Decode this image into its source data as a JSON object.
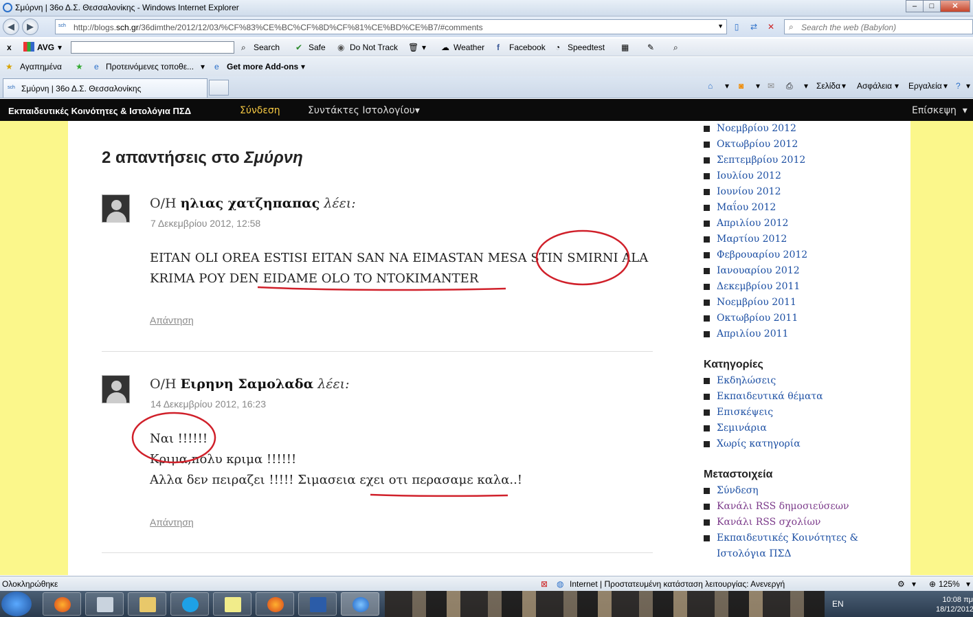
{
  "window": {
    "title": "Σμύρνη | 36ο Δ.Σ. Θεσσαλονίκης - Windows Internet Explorer"
  },
  "navbar": {
    "url_prefix": "http://blogs.",
    "url_domain": "sch.gr",
    "url_rest": "/36dimthe/2012/12/03/%CF%83%CE%BC%CF%8D%CF%81%CE%BD%CE%B7/#comments",
    "search_placeholder": "Search the web (Babylon)"
  },
  "avg_toolbar": {
    "close": "x",
    "brand": "AVG",
    "search": "Search",
    "safe": "Safe",
    "do_not_track": "Do Not Track",
    "weather": "Weather",
    "facebook": "Facebook",
    "speedtest": "Speedtest"
  },
  "favorites_bar": {
    "favorites": "Αγαπημένα",
    "suggested": "Προτεινόμενες τοποθε...",
    "addons": "Get more Add-ons"
  },
  "tab": {
    "title": "Σμύρνη | 36ο Δ.Σ. Θεσσαλονίκης"
  },
  "command_bar": {
    "page": "Σελίδα",
    "safety": "Ασφάλεια",
    "tools": "Εργαλεία"
  },
  "admin_bar": {
    "site": "Εκπαιδευτικές Κοινότητες & Ιστολόγια ΠΣΔ",
    "login": "Σύνδεση",
    "authors": "Συντάκτες Ιστολογίου",
    "visit": "Επίσκεψη"
  },
  "comments": {
    "title_prefix": "2 απαντήσεις στο ",
    "title_post": "Σμύρνη",
    "items": [
      {
        "prefix": "Ο/Η ",
        "author": "ηλιας χατζηπαπας",
        "says": "λέει:",
        "date": "7 Δεκεμβρίου 2012, 12:58",
        "lines": [
          "EITAN OLI OREA ESTISI EITAN SAN NA EIMASTAN MESA STIN SMIRNI ALA",
          "KRIMA POY DEN EIDAME OLO TO NTOKIMANTER"
        ],
        "reply": "Απάντηση"
      },
      {
        "prefix": "Ο/Η ",
        "author": "Ειρηνη Σαμολαδα",
        "says": "λέει:",
        "date": "14 Δεκεμβρίου 2012, 16:23",
        "lines": [
          "Ναι !!!!!!",
          "Κριμα,πολυ κριμα !!!!!!",
          "Αλλα δεν πειραζει !!!!! Σιμασεια εχει οτι περασαμε καλα..!"
        ],
        "reply": "Απάντηση"
      }
    ]
  },
  "sidebar": {
    "archives": [
      "Νοεμβρίου 2012",
      "Οκτωβρίου 2012",
      "Σεπτεμβρίου 2012",
      "Ιουλίου 2012",
      "Ιουνίου 2012",
      "Μαΐου 2012",
      "Απριλίου 2012",
      "Μαρτίου 2012",
      "Φεβρουαρίου 2012",
      "Ιανουαρίου 2012",
      "Δεκεμβρίου 2011",
      "Νοεμβρίου 2011",
      "Οκτωβρίου 2011",
      "Απριλίου 2011"
    ],
    "categories_title": "Κατηγορίες",
    "categories": [
      "Εκδηλώσεις",
      "Εκπαιδευτικά θέματα",
      "Επισκέψεις",
      "Σεμινάρια",
      "Χωρίς κατηγορία"
    ],
    "meta_title": "Μεταστοιχεία",
    "meta": [
      "Σύνδεση",
      "Κανάλι RSS δημοσιεύσεων",
      "Κανάλι RSS σχολίων",
      "Εκπαιδευτικές Κοινότητες &",
      "Ιστολόγια ΠΣΔ"
    ]
  },
  "status_bar": {
    "left": "Ολοκληρώθηκε",
    "zone": "Internet | Προστατευμένη κατάσταση λειτουργίας: Ανενεργή",
    "zoom": "125%"
  },
  "taskbar": {
    "lang": "EN",
    "time": "10:08 πμ",
    "date": "18/12/2012"
  },
  "colors": {
    "page_bg": "#fbf78b",
    "admin_bar": "#0b0b0b",
    "link": "#1c4fa3",
    "annotation_red": "#d0202a"
  }
}
